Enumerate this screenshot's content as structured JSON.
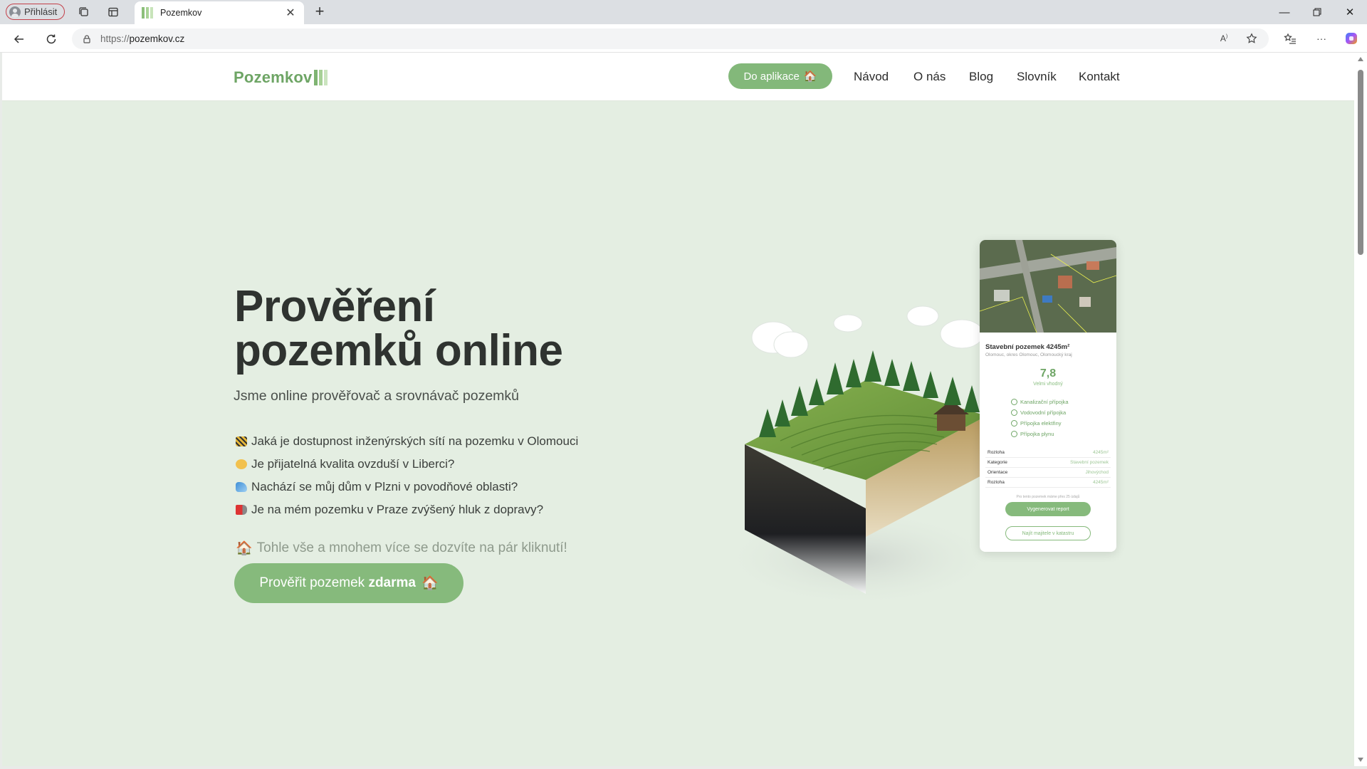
{
  "browser": {
    "profile_label": "Přihlásit",
    "tab_title": "Pozemkov",
    "url_protocol": "https://",
    "url_host": "pozemkov.cz"
  },
  "site": {
    "logo_text": "Pozemkov",
    "brand_color": "#83b87a",
    "nav": {
      "app_button": "Do aplikace",
      "links": [
        "Návod",
        "O nás",
        "Blog",
        "Slovník",
        "Kontakt"
      ]
    }
  },
  "hero": {
    "title_line1": "Prověření",
    "title_line2": "pozemků online",
    "subtitle": "Jsme online prověřovač a srovnávač pozemků",
    "features": [
      "Jaká je dostupnost inženýrských sítí na pozemku v Olomouci",
      "Je přijatelná kvalita ovzduší v Liberci?",
      "Nachází se můj dům v Plzni v povodňové oblasti?",
      "Je na mém pozemku v Praze zvýšený hluk z dopravy?"
    ],
    "cta_note": "Tohle vše a mnohem více se dozvíte na pár kliknutí!",
    "cta_prefix": "Prověřit pozemek",
    "cta_bold": "zdarma"
  },
  "phone": {
    "title": "Stavební pozemek 4245m²",
    "location": "Olomouc, okres Olomouc, Olomoucký kraj",
    "score": "7,8",
    "score_label": "Velmi vhodný",
    "checks": [
      "Kanalizační přípojka",
      "Vodovodní přípojka",
      "Přípojka elektřiny",
      "Přípojka plynu"
    ],
    "table": [
      {
        "k": "Rozloha",
        "v": "4245m²"
      },
      {
        "k": "Kategorie",
        "v": "Stavební pozemek"
      },
      {
        "k": "Orientace",
        "v": "Jihovýchod"
      },
      {
        "k": "Rozloha",
        "v": "4245m²"
      }
    ],
    "note": "Pro tento pozemek máme přes 25 údajů",
    "button_report": "Vygenerovat report",
    "button_cadastre": "Najít majitele v katastru"
  }
}
